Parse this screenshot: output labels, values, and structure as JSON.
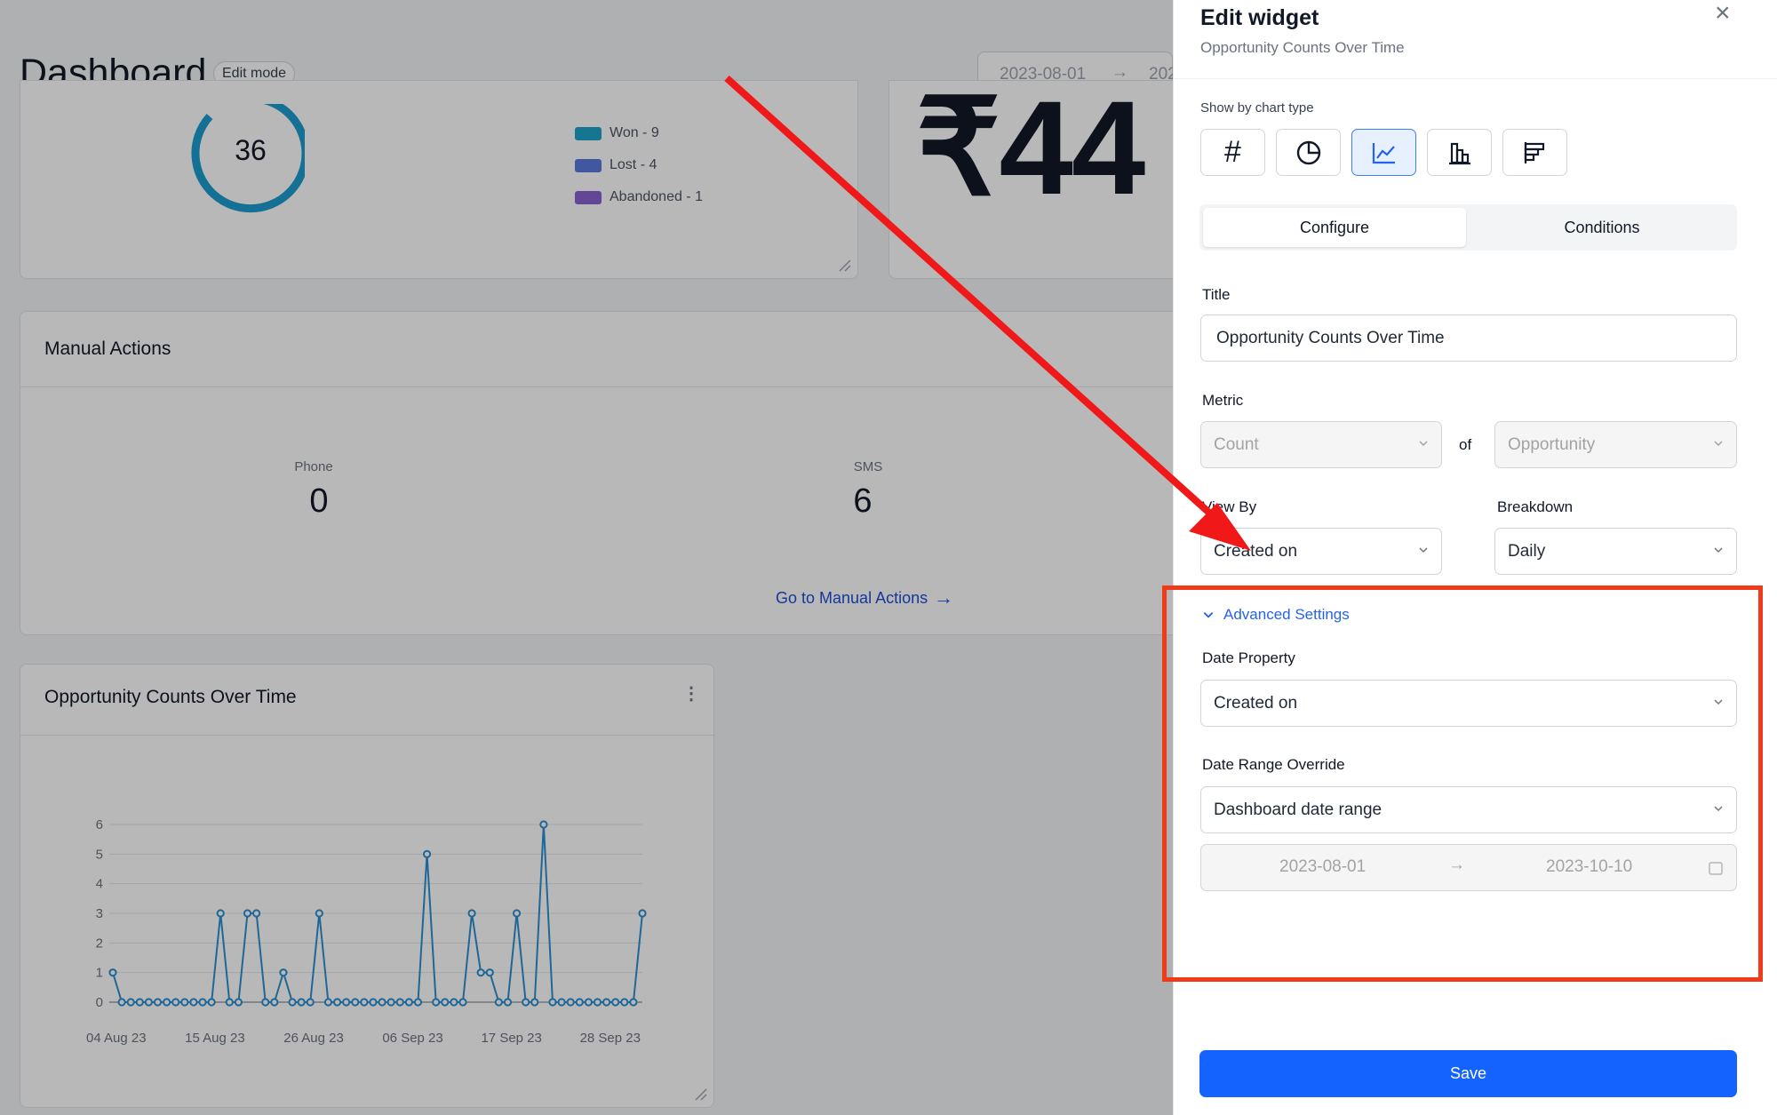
{
  "dashboard": {
    "title": "Dashboard",
    "mode_badge": "Edit mode",
    "date_start": "2023-08-01",
    "date_end_partial": "202",
    "donut": {
      "total": "36",
      "legend": [
        {
          "label": "Won - 9",
          "color": "#1fa3c9"
        },
        {
          "label": "Lost - 4",
          "color": "#5b7be0"
        },
        {
          "label": "Abandoned - 1",
          "color": "#8a63d2"
        }
      ]
    },
    "revenue_partial": "₹44",
    "manual_actions": {
      "title": "Manual Actions",
      "phone_label": "Phone",
      "phone_value": "0",
      "sms_label": "SMS",
      "sms_value": "6",
      "link_label": "Go to Manual Actions"
    },
    "chart_card": {
      "title": "Opportunity Counts Over Time",
      "menu_icon": "kebab-icon"
    }
  },
  "chart_data": {
    "type": "line",
    "title": "Opportunity Counts Over Time",
    "xlabel": "",
    "ylabel": "",
    "ylim": [
      0,
      6
    ],
    "yticks": [
      0,
      1,
      2,
      3,
      4,
      5,
      6
    ],
    "xtick_labels": [
      "04 Aug 23",
      "15 Aug 23",
      "26 Aug 23",
      "06 Sep 23",
      "17 Sep 23",
      "28 Sep 23"
    ],
    "series": [
      {
        "color": "#2b8fd1",
        "values": [
          1,
          0,
          0,
          0,
          0,
          0,
          0,
          0,
          0,
          0,
          0,
          0,
          3,
          0,
          0,
          3,
          3,
          0,
          0,
          1,
          0,
          0,
          0,
          3,
          0,
          0,
          0,
          0,
          0,
          0,
          0,
          0,
          0,
          0,
          0,
          5,
          0,
          0,
          0,
          0,
          3,
          1,
          1,
          0,
          0,
          3,
          0,
          0,
          6,
          0,
          0,
          0,
          0,
          0,
          0,
          0,
          0,
          0,
          0,
          3
        ]
      }
    ]
  },
  "panel": {
    "title": "Edit widget",
    "subtitle": "Opportunity Counts Over Time",
    "chart_type_label": "Show by chart type",
    "chart_types": [
      "number",
      "pie",
      "line",
      "bar",
      "horizontal-bar"
    ],
    "active_chart_type": "line",
    "tabs": [
      "Configure",
      "Conditions"
    ],
    "active_tab": "Configure",
    "title_label": "Title",
    "title_value": "Opportunity Counts Over Time",
    "metric_label": "Metric",
    "metric_value": "Count",
    "of_label": "of",
    "metric_object": "Opportunity",
    "view_by_label": "View By",
    "view_by_value": "Created on",
    "breakdown_label": "Breakdown",
    "breakdown_value": "Daily",
    "advanced_label": "Advanced Settings",
    "date_property_label": "Date Property",
    "date_property_value": "Created on",
    "date_range_label": "Date Range Override",
    "date_range_value": "Dashboard date range",
    "range_start": "2023-08-01",
    "range_end": "2023-10-10",
    "save_label": "Save"
  },
  "annotation": {
    "arrow_color": "#f01818",
    "box_color": "#f03a1a"
  }
}
